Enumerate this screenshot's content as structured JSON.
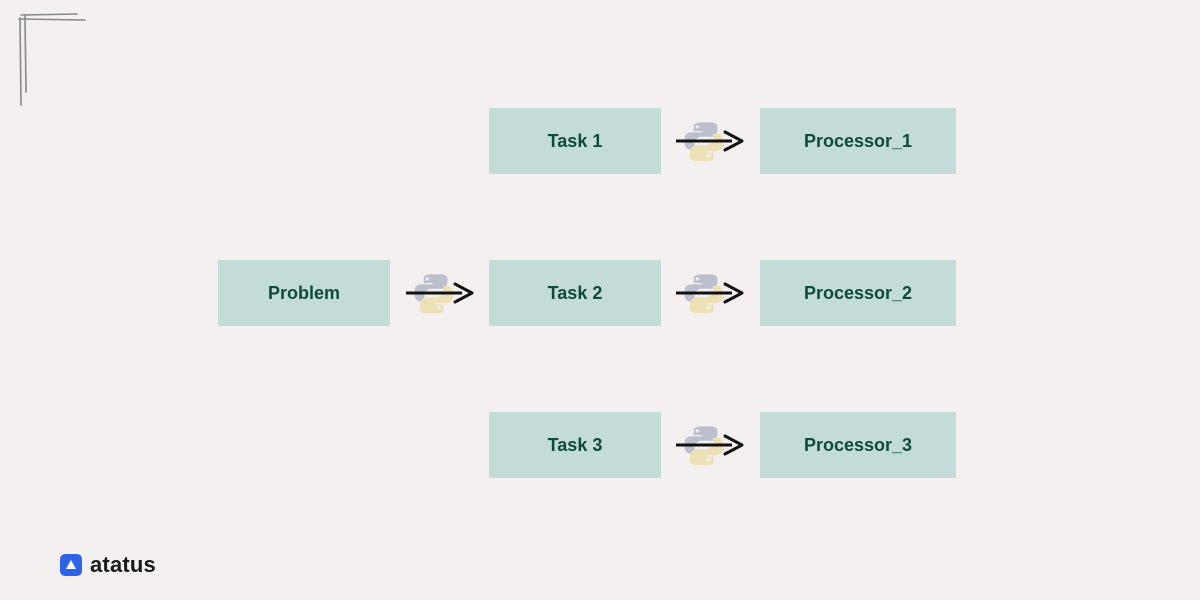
{
  "diagram": {
    "problem": "Problem",
    "tasks": [
      "Task 1",
      "Task 2",
      "Task 3"
    ],
    "processors": [
      "Processor_1",
      "Processor_2",
      "Processor_3"
    ]
  },
  "branding": {
    "name": "atatus"
  },
  "colors": {
    "box_bg": "#c4dcd7",
    "box_text": "#0e4a3d",
    "page_bg": "#f4f0ef",
    "brand_blue": "#2e63e7"
  }
}
